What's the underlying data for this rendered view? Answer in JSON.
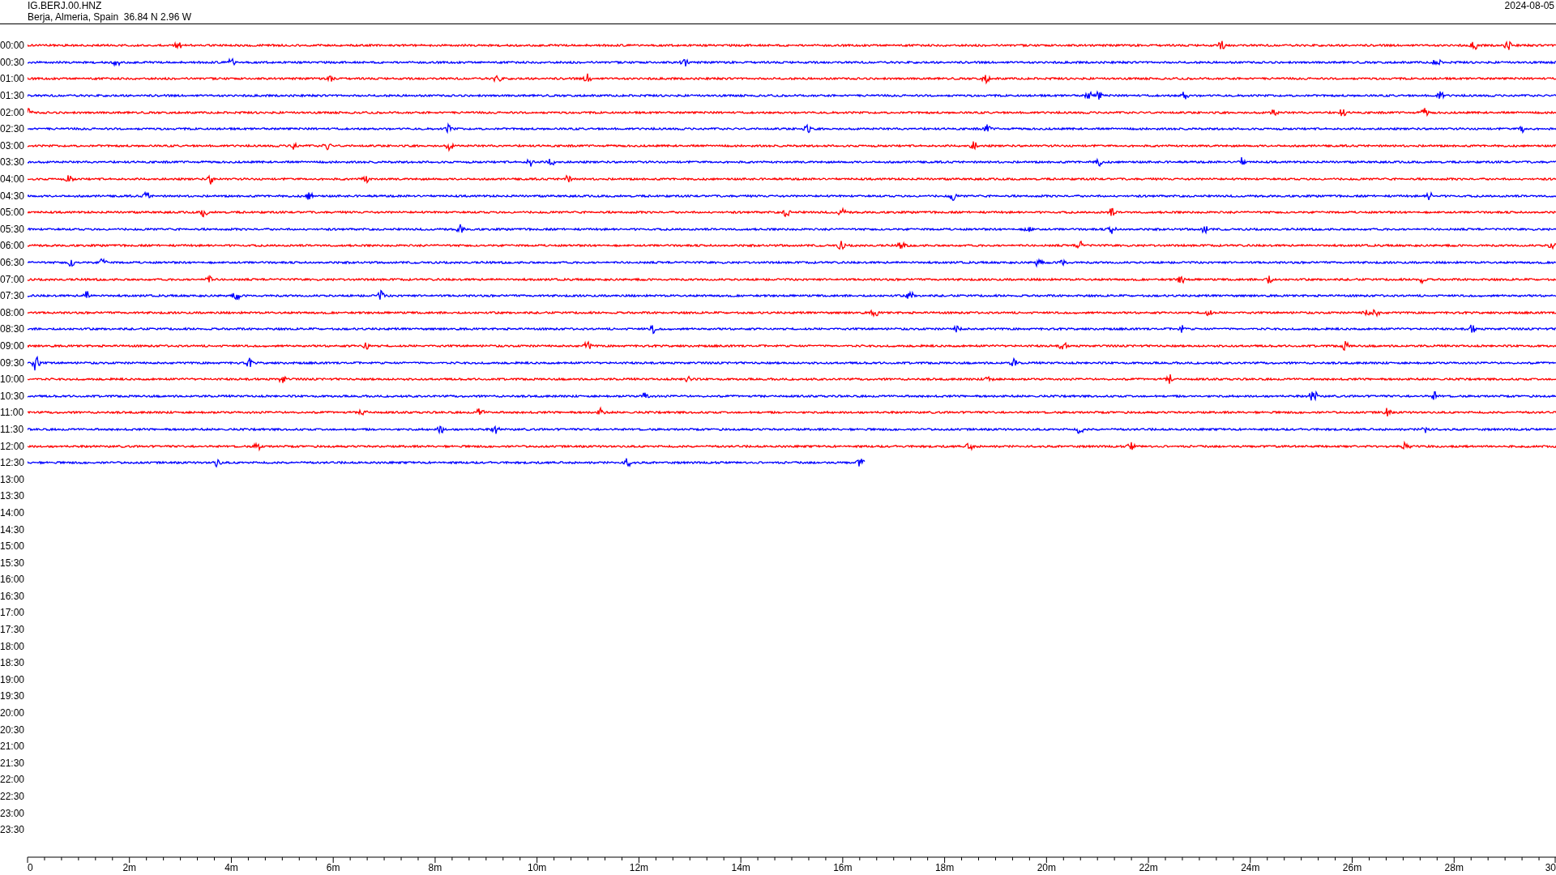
{
  "header": {
    "station": "IG.BERJ.00.HNZ",
    "location": "Berja, Almeria, Spain  36.84 N 2.96 W",
    "date": "2024-08-05"
  },
  "rows": [
    {
      "label": "00:00",
      "color": "#ff0000",
      "level": 1
    },
    {
      "label": "00:30",
      "color": "#0000ff",
      "level": 1
    },
    {
      "label": "01:00",
      "color": "#ff0000",
      "level": 1
    },
    {
      "label": "01:30",
      "color": "#0000ff",
      "level": 1
    },
    {
      "label": "02:00",
      "color": "#ff0000",
      "level": 1
    },
    {
      "label": "02:30",
      "color": "#0000ff",
      "level": 1
    },
    {
      "label": "03:00",
      "color": "#ff0000",
      "level": 1
    },
    {
      "label": "03:30",
      "color": "#0000ff",
      "level": 1
    },
    {
      "label": "04:00",
      "color": "#ff0000",
      "level": 1
    },
    {
      "label": "04:30",
      "color": "#0000ff",
      "level": 1
    },
    {
      "label": "05:00",
      "color": "#ff0000",
      "level": 1
    },
    {
      "label": "05:30",
      "color": "#0000ff",
      "level": 1
    },
    {
      "label": "06:00",
      "color": "#ff0000",
      "level": 1
    },
    {
      "label": "06:30",
      "color": "#0000ff",
      "level": 1
    },
    {
      "label": "07:00",
      "color": "#ff0000",
      "level": 1
    },
    {
      "label": "07:30",
      "color": "#0000ff",
      "level": 1
    },
    {
      "label": "08:00",
      "color": "#ff0000",
      "level": 1
    },
    {
      "label": "08:30",
      "color": "#0000ff",
      "level": 1
    },
    {
      "label": "09:00",
      "color": "#ff0000",
      "level": 1
    },
    {
      "label": "09:30",
      "color": "#0000ff",
      "level": 1
    },
    {
      "label": "10:00",
      "color": "#ff0000",
      "level": 1
    },
    {
      "label": "10:30",
      "color": "#0000ff",
      "level": 1
    },
    {
      "label": "11:00",
      "color": "#ff0000",
      "level": 1
    },
    {
      "label": "11:30",
      "color": "#0000ff",
      "level": 1
    },
    {
      "label": "12:00",
      "color": "#ff0000",
      "level": 1
    },
    {
      "label": "12:30",
      "color": "#0000ff",
      "level": 0.548
    },
    {
      "label": "13:00"
    },
    {
      "label": "13:30"
    },
    {
      "label": "14:00"
    },
    {
      "label": "14:30"
    },
    {
      "label": "15:00"
    },
    {
      "label": "15:30"
    },
    {
      "label": "16:00"
    },
    {
      "label": "16:30"
    },
    {
      "label": "17:00"
    },
    {
      "label": "17:30"
    },
    {
      "label": "18:00"
    },
    {
      "label": "18:30"
    },
    {
      "label": "19:00"
    },
    {
      "label": "19:30"
    },
    {
      "label": "20:00"
    },
    {
      "label": "20:30"
    },
    {
      "label": "21:00"
    },
    {
      "label": "21:30"
    },
    {
      "label": "22:00"
    },
    {
      "label": "22:30"
    },
    {
      "label": "23:00"
    },
    {
      "label": "23:30"
    }
  ],
  "x_axis": {
    "labels": [
      "0",
      "2m",
      "4m",
      "6m",
      "8m",
      "10m",
      "12m",
      "14m",
      "16m",
      "18m",
      "20m",
      "22m",
      "24m",
      "26m",
      "28m",
      "30"
    ]
  }
}
